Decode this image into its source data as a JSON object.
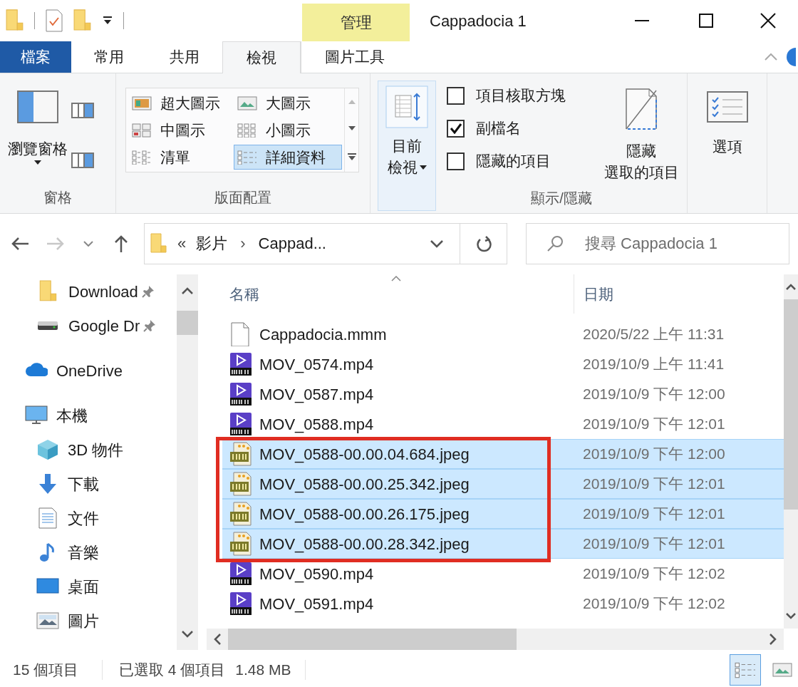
{
  "title_bar": {
    "contextual_tab": "管理",
    "title": "Cappadocia 1"
  },
  "ribbon_tabs": [
    {
      "label": "檔案",
      "kind": "file",
      "selected": false
    },
    {
      "label": "常用",
      "kind": "tab",
      "selected": false
    },
    {
      "label": "共用",
      "kind": "tab",
      "selected": false
    },
    {
      "label": "檢視",
      "kind": "tab",
      "selected": true
    },
    {
      "label": "圖片工具",
      "kind": "contextual",
      "selected": false
    }
  ],
  "ribbon": {
    "panes": {
      "button": "瀏覽窗格",
      "group": "窗格"
    },
    "layout": {
      "group": "版面配置",
      "items": [
        {
          "label": "超大圖示",
          "kind": "extra-large",
          "selected": false
        },
        {
          "label": "大圖示",
          "kind": "large",
          "selected": false
        },
        {
          "label": "中圖示",
          "kind": "medium",
          "selected": false
        },
        {
          "label": "小圖示",
          "kind": "small",
          "selected": false
        },
        {
          "label": "清單",
          "kind": "list",
          "selected": false
        },
        {
          "label": "詳細資料",
          "kind": "details",
          "selected": true
        }
      ]
    },
    "current_view": [
      "目前",
      "檢視"
    ],
    "show_hide": {
      "group": "顯示/隱藏",
      "checkboxes": [
        {
          "label": "項目核取方塊",
          "checked": false
        },
        {
          "label": "副檔名",
          "checked": true
        },
        {
          "label": "隱藏的項目",
          "checked": false
        }
      ],
      "hide_selected": [
        "隱藏",
        "選取的項目"
      ]
    },
    "options": "選項"
  },
  "navigation": {
    "buttons": [
      {
        "kind": "back",
        "disabled": false
      },
      {
        "kind": "forward",
        "disabled": true
      },
      {
        "kind": "recent",
        "disabled": false
      },
      {
        "kind": "up",
        "disabled": false
      }
    ]
  },
  "address": {
    "overflow": "«",
    "crumbs": [
      "影片",
      "Cappad..."
    ],
    "separator": "›"
  },
  "search": {
    "placeholder": "搜尋 Cappadocia 1"
  },
  "sidebar": {
    "quick_access": [
      {
        "label": "Download",
        "kind": "folder",
        "pinned": true
      },
      {
        "label": "Google Dr",
        "kind": "drive",
        "pinned": true
      }
    ],
    "tree": [
      {
        "label": "OneDrive",
        "kind": "cloud"
      },
      {
        "label": "本機",
        "kind": "pc",
        "children": [
          {
            "label": "3D 物件",
            "kind": "objects"
          },
          {
            "label": "下載",
            "kind": "download"
          },
          {
            "label": "文件",
            "kind": "documents"
          },
          {
            "label": "音樂",
            "kind": "music"
          },
          {
            "label": "桌面",
            "kind": "desktop"
          },
          {
            "label": "圖片",
            "kind": "pictures"
          }
        ]
      }
    ]
  },
  "file_list": {
    "columns": [
      "名稱",
      "日期"
    ],
    "rows": [
      {
        "name": "Cappadocia.mmm",
        "date": "2020/5/22 上午 11:31",
        "kind": "file",
        "selected": false,
        "annotated": false
      },
      {
        "name": "MOV_0574.mp4",
        "date": "2019/10/9 上午 11:41",
        "kind": "mp4",
        "selected": false,
        "annotated": false
      },
      {
        "name": "MOV_0587.mp4",
        "date": "2019/10/9 下午 12:00",
        "kind": "mp4",
        "selected": false,
        "annotated": false
      },
      {
        "name": "MOV_0588.mp4",
        "date": "2019/10/9 下午 12:01",
        "kind": "mp4",
        "selected": false,
        "annotated": false
      },
      {
        "name": "MOV_0588-00.00.04.684.jpeg",
        "date": "2019/10/9 下午 12:00",
        "kind": "jpg",
        "selected": true,
        "annotated": true
      },
      {
        "name": "MOV_0588-00.00.25.342.jpeg",
        "date": "2019/10/9 下午 12:01",
        "kind": "jpg",
        "selected": true,
        "annotated": true
      },
      {
        "name": "MOV_0588-00.00.26.175.jpeg",
        "date": "2019/10/9 下午 12:01",
        "kind": "jpg",
        "selected": true,
        "annotated": true
      },
      {
        "name": "MOV_0588-00.00.28.342.jpeg",
        "date": "2019/10/9 下午 12:01",
        "kind": "jpg",
        "selected": true,
        "annotated": true
      },
      {
        "name": "MOV_0590.mp4",
        "date": "2019/10/9 下午 12:02",
        "kind": "mp4",
        "selected": false,
        "annotated": false
      },
      {
        "name": "MOV_0591.mp4",
        "date": "2019/10/9 下午 12:02",
        "kind": "mp4",
        "selected": false,
        "annotated": false
      }
    ]
  },
  "status_bar": {
    "count": "15 個項目",
    "selection": "已選取 4 個項目",
    "size": "1.48 MB",
    "views": [
      {
        "kind": "details",
        "selected": true
      },
      {
        "kind": "large-icons",
        "selected": false
      }
    ]
  }
}
